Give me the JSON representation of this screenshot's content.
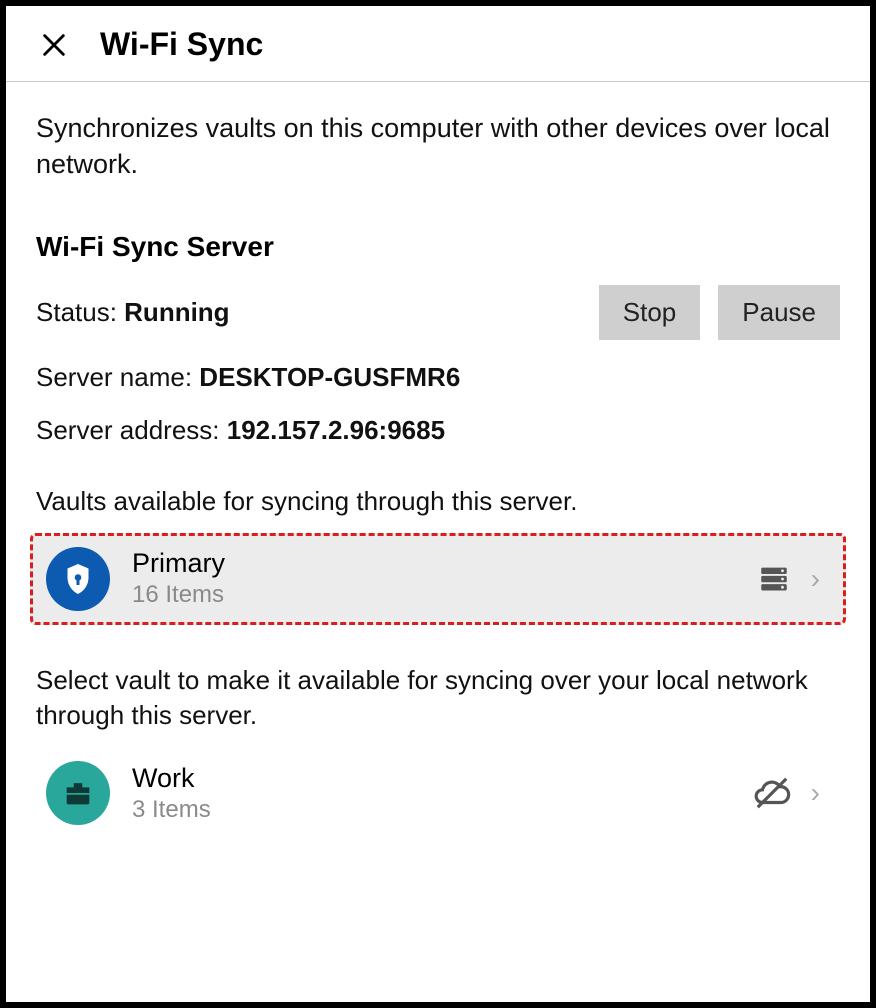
{
  "header": {
    "title": "Wi-Fi Sync"
  },
  "description": "Synchronizes vaults on this computer with other devices over local network.",
  "section_title": "Wi-Fi Sync Server",
  "status": {
    "label": "Status: ",
    "value": "Running"
  },
  "buttons": {
    "stop": "Stop",
    "pause": "Pause"
  },
  "server_name": {
    "label": "Server name: ",
    "value": "DESKTOP-GUSFMR6"
  },
  "server_address": {
    "label": "Server address: ",
    "value": "192.157.2.96:9685"
  },
  "vaults_available_label": "Vaults available for syncing through this server.",
  "vault_primary": {
    "name": "Primary",
    "count": "16 Items"
  },
  "select_vault_label": "Select vault to make it available for syncing over your local network through this server.",
  "vault_work": {
    "name": "Work",
    "count": "3 Items"
  }
}
